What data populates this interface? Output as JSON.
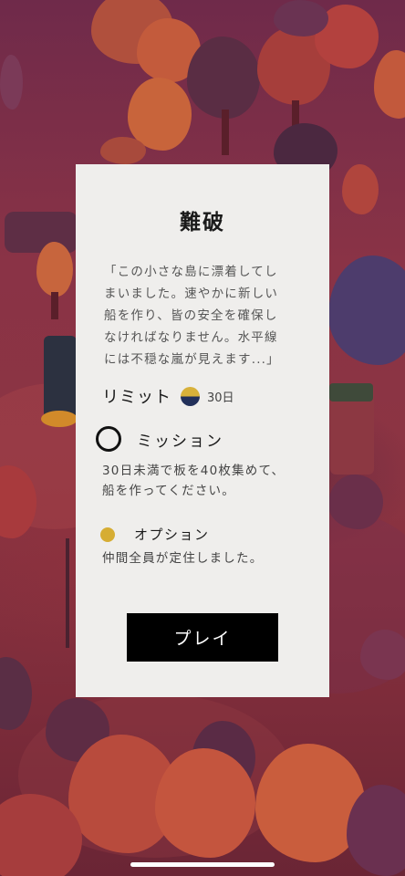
{
  "scene": {
    "description_colors": {
      "sky": "#6f2a4a",
      "ground": "#8c3442",
      "tree_dark": "#5e2a3f",
      "tree_orange": "#c5563e",
      "tree_purple": "#4a3a66"
    }
  },
  "dialog": {
    "title": "難破",
    "story_lines": [
      "「この小さな島に漂着してし",
      "まいました。速やかに新しい",
      "船を作り、皆の安全を確保し",
      "なければなりません。水平線",
      "には不穏な嵐が見えます...」"
    ],
    "limit": {
      "label": "リミット",
      "icon": "day-night-icon",
      "icon_colors": {
        "top": "#d8b13a",
        "bottom": "#22305a"
      },
      "days": "30日"
    },
    "mission": {
      "icon": "empty-ring-icon",
      "title": "ミッション",
      "description_lines": [
        "30日未満で板を40枚集めて、",
        "船を作ってください。"
      ]
    },
    "option": {
      "icon": "gold-dot-icon",
      "icon_color": "#d6ad33",
      "title": "オプション",
      "description": "仲間全員が定住しました。"
    },
    "play_button": "プレイ"
  }
}
